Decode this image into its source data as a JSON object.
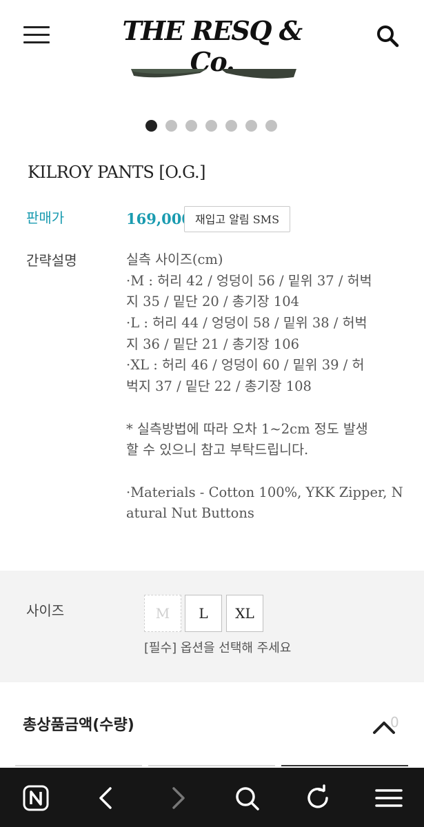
{
  "header": {
    "brand": "THE RESQ & Co.",
    "menu_icon": "hamburger-menu-icon",
    "search_icon": "search-icon"
  },
  "carousel": {
    "total": 7,
    "active_index": 0
  },
  "product": {
    "title": "KILROY PANTS [O.G.]",
    "price_label": "판매가",
    "price": "169,000",
    "restock_button": "재입고 알림 SMS",
    "desc_label": "간략설명",
    "description": [
      "실측 사이즈(cm)",
      "·M : 허리 42 / 엉덩이 56 / 밑위 37 / 허벅",
      "지 35 / 밑단 20 / 총기장 104",
      "·L : 허리 44 / 엉덩이 58 / 밑위 38 / 허벅",
      "지 36 / 밑단 21 / 총기장 106",
      "·XL : 허리 46 / 엉덩이 60 / 밑위 39 / 허",
      "벅지 37 / 밑단 22 / 총기장 108",
      "",
      " * 실측방법에 따라 오차 1~2cm 정도 발생",
      "할 수 있으니 참고 부탁드립니다.",
      "",
      "·Materials - Cotton 100%, YKK Zipper, N",
      "atural Nut Buttons"
    ]
  },
  "options": {
    "size_label": "사이즈",
    "sizes": [
      {
        "label": "M",
        "disabled": true
      },
      {
        "label": "L",
        "disabled": false
      },
      {
        "label": "XL",
        "disabled": false
      }
    ],
    "hint": "[필수] 옵션을 선택해 주세요"
  },
  "total": {
    "label": "총상품금액(수량)",
    "count": "0"
  },
  "browser_nav": {
    "icons": [
      "naver-icon",
      "back-icon",
      "forward-icon",
      "search-icon",
      "refresh-icon",
      "menu-icon"
    ]
  },
  "colors": {
    "accent": "#1a9bb0",
    "nav_bg": "#161616",
    "option_bg": "#f3f3f3"
  }
}
